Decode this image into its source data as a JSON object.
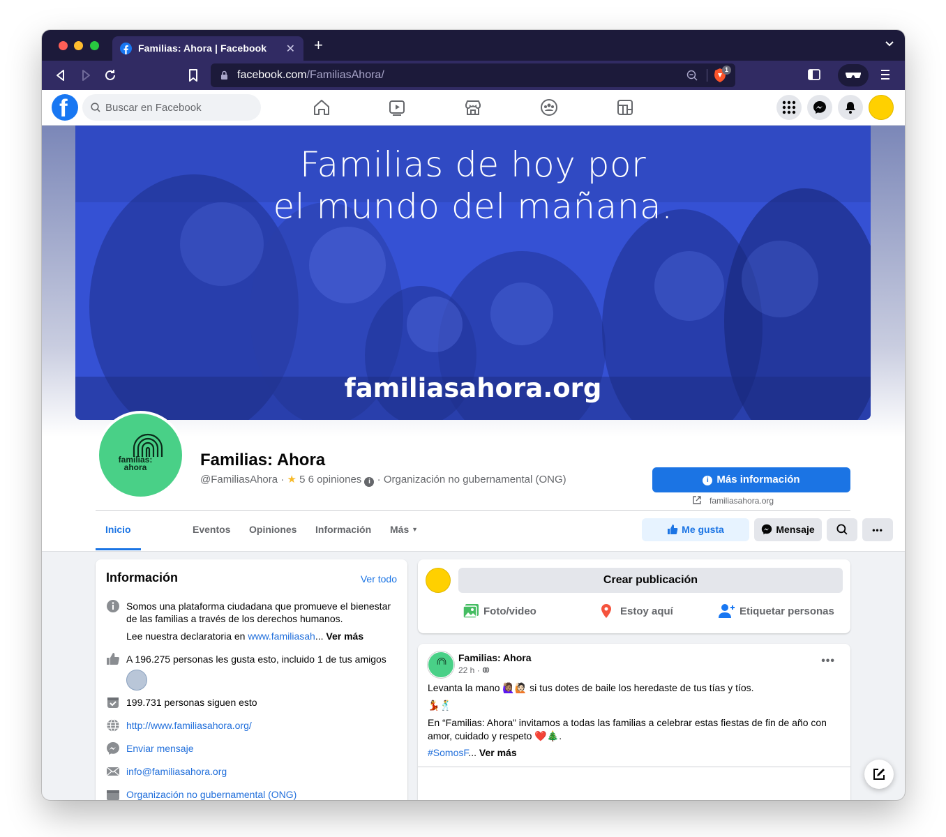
{
  "browser": {
    "tab_title": "Familias: Ahora | Facebook",
    "tab_close": "✕",
    "new_tab": "+",
    "url_domain": "facebook.com",
    "url_path": "/FamiliasAhora/",
    "shields_count": "1"
  },
  "fb_header": {
    "search_placeholder": "Buscar en Facebook",
    "nav_icons": [
      "home-icon",
      "watch-icon",
      "marketplace-icon",
      "groups-icon",
      "gaming-icon"
    ],
    "right_icons": [
      "menu-grid-icon",
      "messenger-icon",
      "notifications-icon"
    ]
  },
  "cover": {
    "headline_line1": "Familias de hoy por",
    "headline_line2": "el mundo del mañana.",
    "url": "familiasahora.org",
    "tint": "#3a5de0"
  },
  "profile": {
    "logo_line1": "familias:",
    "logo_line2": "ahora",
    "name": "Familias: Ahora",
    "handle": "@FamiliasAhora",
    "separator": "·",
    "rating_value": "5",
    "reviews": "6 opiniones",
    "category": "Organización no gubernamental (ONG)",
    "more_info_button": "Más información",
    "website": "familiasahora.org"
  },
  "tabs": [
    {
      "label": "Inicio",
      "active": true
    },
    {
      "label": "Eventos",
      "active": false
    },
    {
      "label": "Opiniones",
      "active": false
    },
    {
      "label": "Información",
      "active": false
    },
    {
      "label": "Más",
      "active": false
    }
  ],
  "actions": {
    "like": "Me gusta",
    "message": "Mensaje"
  },
  "intro": {
    "title": "Información",
    "see_all": "Ver todo",
    "description": "Somos una plataforma ciudadana que promueve el bienestar de las familias a través de los derechos humanos.",
    "declaration_prefix": "Lee nuestra declaratoria en ",
    "declaration_link": "www.familiasah",
    "declaration_ellipsis": "... ",
    "see_more": "Ver más",
    "likes": "A 196.275 personas les gusta esto, incluido 1 de tus amigos",
    "followers": "199.731 personas siguen esto",
    "website": "http://www.familiasahora.org/",
    "send_message": "Enviar mensaje",
    "email": "info@familiasahora.org",
    "category": "Organización no gubernamental (ONG)"
  },
  "composer": {
    "create_post": "Crear publicación",
    "photo_video": "Foto/video",
    "checkin": "Estoy aquí",
    "tag_people": "Etiquetar personas"
  },
  "post": {
    "author": "Familias: Ahora",
    "time": "22 h",
    "time_sep": "·",
    "more": "•••",
    "line1_prefix": "Levanta la mano ",
    "line1_emoji": "🙋🏽‍♀️🙋🏻",
    "line1_suffix": " si tus dotes de baile los heredaste de tus tías y tíos.",
    "line2_emoji": "💃🕺",
    "line3": "En “Familias: Ahora” invitamos a todas las familias a celebrar estas fiestas de fin de año con amor, cuidado y respeto ",
    "line3_emoji": "❤️🎄",
    "line3_end": ".",
    "hashtag": "#SomosF",
    "ellipsis": "... ",
    "see_more": "Ver más"
  },
  "colors": {
    "fb_blue": "#1877f2",
    "link_blue": "#1b74e4",
    "browser_chrome": "#312b63",
    "page_logo_green": "#49d087",
    "user_avatar": "#ffd000"
  }
}
